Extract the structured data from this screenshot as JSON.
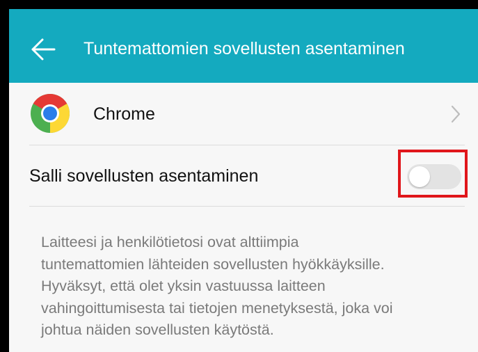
{
  "header": {
    "title": "Tuntemattomien sovellusten asentaminen",
    "back_icon": "arrow-left-icon",
    "background": "#14aabf"
  },
  "app_row": {
    "icon": "chrome-logo-icon",
    "name": "Chrome",
    "chevron_icon": "chevron-right-icon"
  },
  "toggle_row": {
    "label": "Salli sovellusten asentaminen",
    "enabled": false,
    "highlight_color": "#e0161b"
  },
  "description": {
    "lines": [
      "Laitteesi ja henkilötietosi ovat alttiimpia",
      "tuntemattomien lähteiden sovellusten hyökkäyksille.",
      "Hyväksyt, että olet yksin vastuussa laitteen",
      "vahingoittumisesta tai tietojen menetyksestä, joka voi",
      "johtua näiden sovellusten käytöstä."
    ]
  }
}
